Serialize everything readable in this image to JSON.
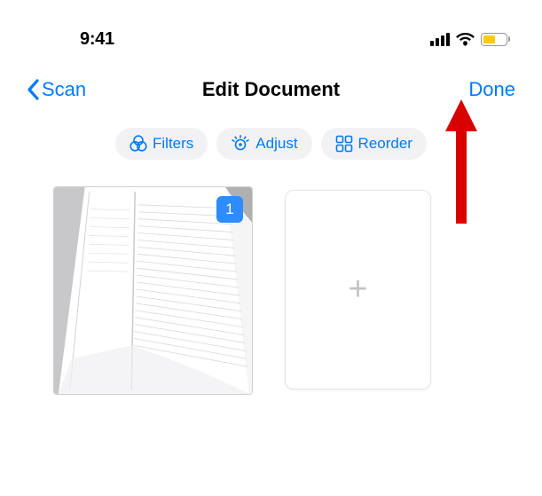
{
  "status": {
    "time": "9:41"
  },
  "nav": {
    "back_label": "Scan",
    "title": "Edit Document",
    "done_label": "Done"
  },
  "toolbar": {
    "filters_label": "Filters",
    "adjust_label": "Adjust",
    "reorder_label": "Reorder"
  },
  "pages": {
    "first_number": "1",
    "add_symbol": "+"
  },
  "colors": {
    "accent": "#007aff",
    "battery_fill": "#ffcc00",
    "annotation_red": "#d90000"
  }
}
